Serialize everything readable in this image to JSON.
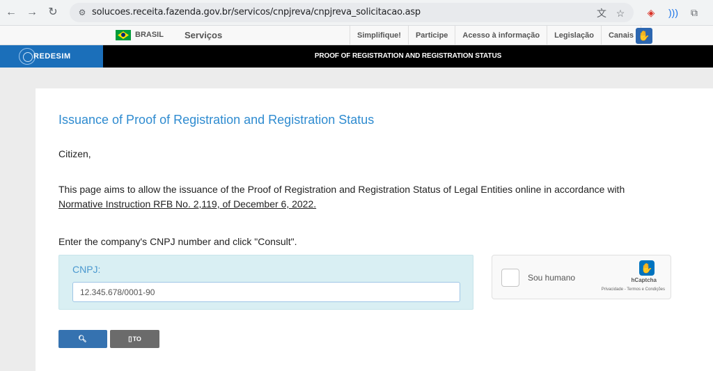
{
  "browser": {
    "url": "solucoes.receita.fazenda.gov.br/servicos/cnpjreva/cnpjreva_solicitacao.asp"
  },
  "govbar": {
    "country": "BRASIL",
    "services": "Serviços",
    "links": [
      "Simplifique!",
      "Participe",
      "Acesso à informação",
      "Legislação",
      "Canais"
    ]
  },
  "redesim": {
    "logo": "REDESIM",
    "title": "PROOF OF REGISTRATION AND REGISTRATION STATUS"
  },
  "content": {
    "title": "Issuance of Proof of Registration and Registration Status",
    "greeting": "Citizen,",
    "description": "This page aims to allow the issuance of the Proof of Registration and Registration Status of Legal Entities online in accordance with ",
    "description_link": "Normative Instruction RFB No. 2,119, of December 6, 2022.",
    "instruction": "Enter the company's CNPJ number and click \"Consult\".",
    "cnpj_label": "CNPJ:",
    "cnpj_value": "12.345.678/0001-90"
  },
  "captcha": {
    "label": "Sou humano",
    "brand": "hCaptcha",
    "links": "Privacidade - Termos e Condições"
  },
  "buttons": {
    "consult": "CONSULT",
    "clean": "TO CLEAN"
  }
}
